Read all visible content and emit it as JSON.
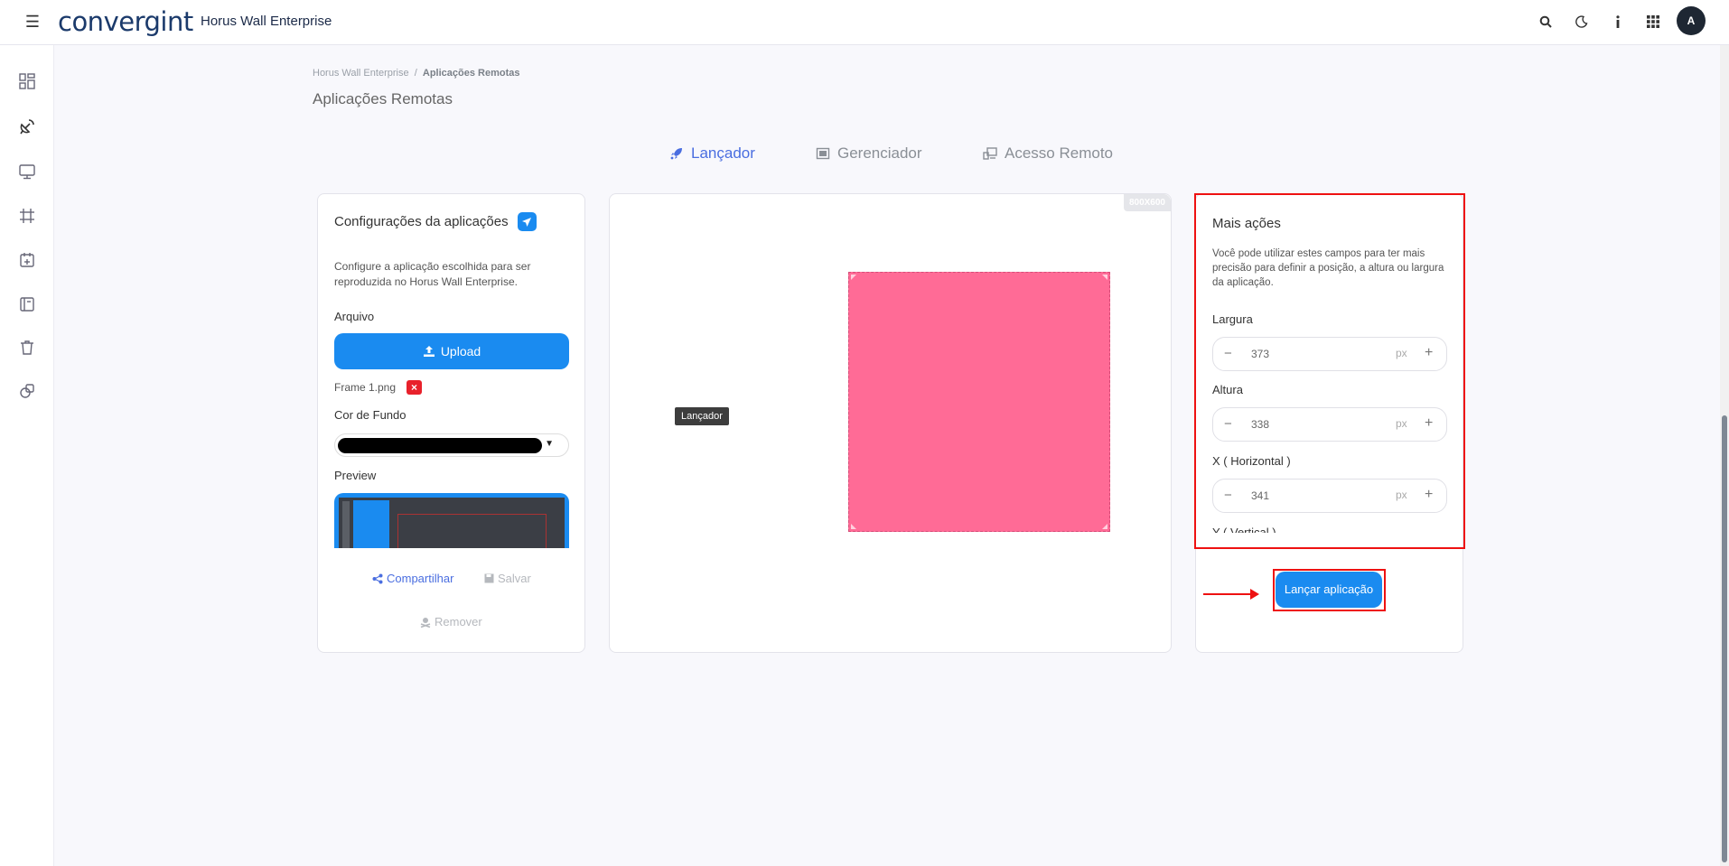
{
  "header": {
    "brand": "convergint",
    "app_title": "Horus Wall Enterprise",
    "avatar_initial": "A"
  },
  "breadcrumb": {
    "root": "Horus Wall Enterprise",
    "separator": "/",
    "current": "Aplicações Remotas"
  },
  "page_title": "Aplicações Remotas",
  "tabs": [
    {
      "label": "Lançador",
      "active": true
    },
    {
      "label": "Gerenciador",
      "active": false
    },
    {
      "label": "Acesso Remoto",
      "active": false
    }
  ],
  "config_card": {
    "title": "Configurações da aplicações",
    "description": "Configure a aplicação escolhida para ser reproduzida no Horus Wall Enterprise.",
    "file_label": "Arquivo",
    "upload_label": "Upload",
    "file_name": "Frame 1.png",
    "bg_color_label": "Cor de Fundo",
    "bg_color_value": "#000000",
    "preview_label": "Preview",
    "share_label": "Compartilhar",
    "save_label": "Salvar",
    "remove_label": "Remover"
  },
  "canvas": {
    "resolution": "800X600",
    "launcher_tooltip": "Lançador",
    "app_color": "#ff6b96"
  },
  "more_actions": {
    "title": "Mais ações",
    "description": "Você pode utilizar estes campos para ter mais precisão para definir a posição, a altura ou largura da aplicação.",
    "fields": [
      {
        "label": "Largura",
        "value": "373",
        "unit": "px"
      },
      {
        "label": "Altura",
        "value": "338",
        "unit": "px"
      },
      {
        "label": "X ( Horizontal )",
        "value": "341",
        "unit": "px"
      }
    ],
    "partial_label": "Y ( Vertical )",
    "launch_label": "Lançar aplicação"
  },
  "colors": {
    "accent": "#1a8bf0",
    "tab_active": "#4a6ee0",
    "annotation": "#e11111"
  }
}
